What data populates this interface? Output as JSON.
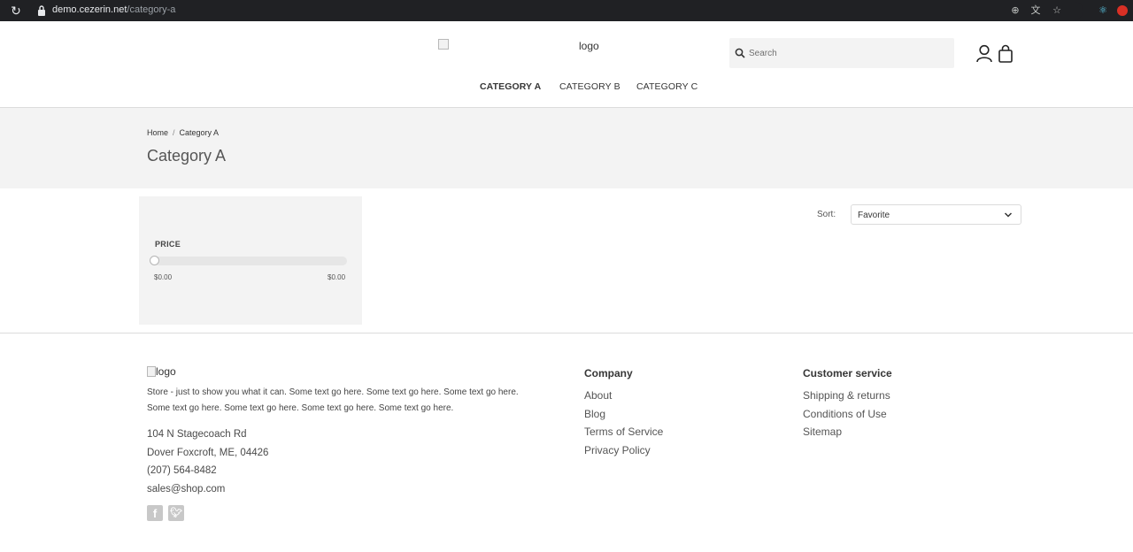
{
  "browser": {
    "url_host": "demo.cezerin.net",
    "url_path": "/category-a"
  },
  "header": {
    "logo_alt": "logo",
    "search_placeholder": "Search",
    "nav": [
      {
        "label": "CATEGORY A",
        "active": true
      },
      {
        "label": "CATEGORY B",
        "active": false
      },
      {
        "label": "CATEGORY C",
        "active": false
      }
    ]
  },
  "breadcrumb": {
    "home": "Home",
    "separator": "/",
    "current": "Category A"
  },
  "page": {
    "title": "Category A"
  },
  "filter": {
    "price_label": "PRICE",
    "min_price": "$0.00",
    "max_price": "$0.00"
  },
  "sort": {
    "label": "Sort:",
    "selected": "Favorite"
  },
  "footer": {
    "logo_alt": "logo",
    "description": "Store - just to show you what it can. Some text go here. Some text go here. Some text go here. Some text go here. Some text go here. Some text go here. Some text go here.",
    "address_line1": "104 N Stagecoach Rd",
    "address_line2": "Dover Foxcroft, ME, 04426",
    "phone": "(207) 564-8482",
    "email": "sales@shop.com",
    "company": {
      "title": "Company",
      "links": [
        "About",
        "Blog",
        "Terms of Service",
        "Privacy Policy"
      ]
    },
    "customer_service": {
      "title": "Customer service",
      "links": [
        "Shipping & returns",
        "Conditions of Use",
        "Sitemap"
      ]
    }
  }
}
